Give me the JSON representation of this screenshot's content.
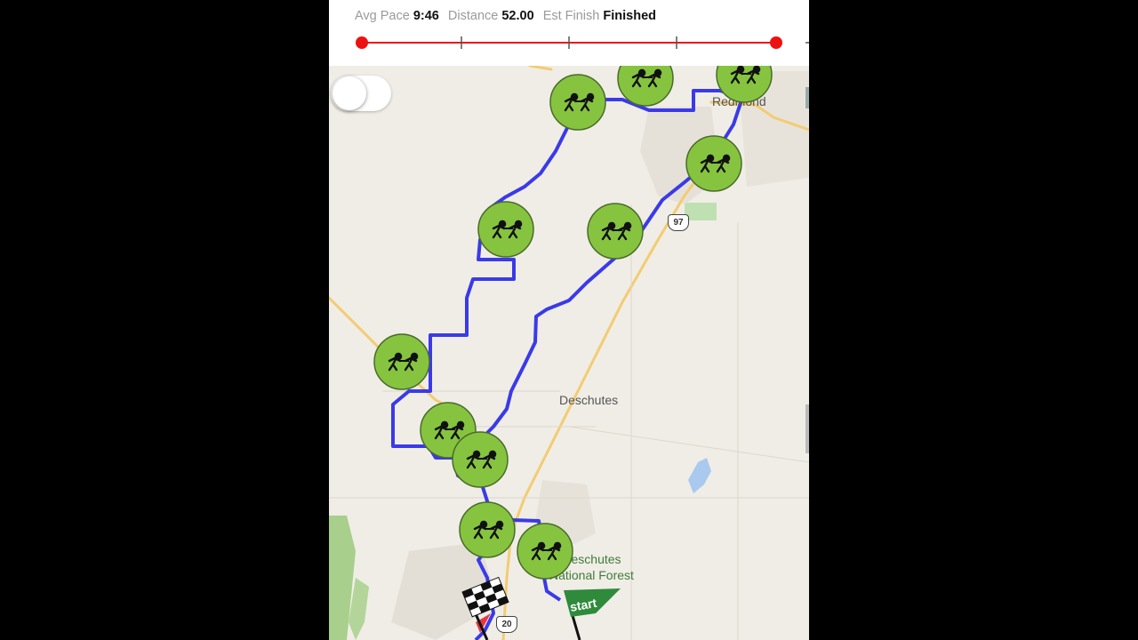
{
  "stats": {
    "avg_pace_label": "Avg Pace",
    "avg_pace_value": "9:46",
    "distance_label": "Distance",
    "distance_value": "52.00",
    "est_finish_label": "Est Finish",
    "est_finish_value": "Finished"
  },
  "progress": {
    "fraction": 1.0,
    "color": "#ee1111"
  },
  "map": {
    "labels": {
      "redmond": "Redmond",
      "deschutes": "Deschutes",
      "forest_line1": "Deschutes",
      "forest_line2": "National Forest"
    },
    "shields": {
      "us97": "97",
      "us20": "20"
    },
    "route_color": "#3a3ae8",
    "marker_color": "#86c440",
    "start_flag_label": "start",
    "markers": [
      {
        "icon": "relay-runners-icon"
      },
      {
        "icon": "relay-runners-icon"
      },
      {
        "icon": "relay-runners-icon"
      },
      {
        "icon": "relay-runners-icon"
      },
      {
        "icon": "relay-runners-icon"
      },
      {
        "icon": "relay-runners-icon"
      },
      {
        "icon": "relay-runners-icon"
      },
      {
        "icon": "relay-runners-icon"
      },
      {
        "icon": "relay-runners-icon"
      },
      {
        "icon": "relay-runners-icon"
      },
      {
        "icon": "relay-runners-icon"
      }
    ]
  }
}
